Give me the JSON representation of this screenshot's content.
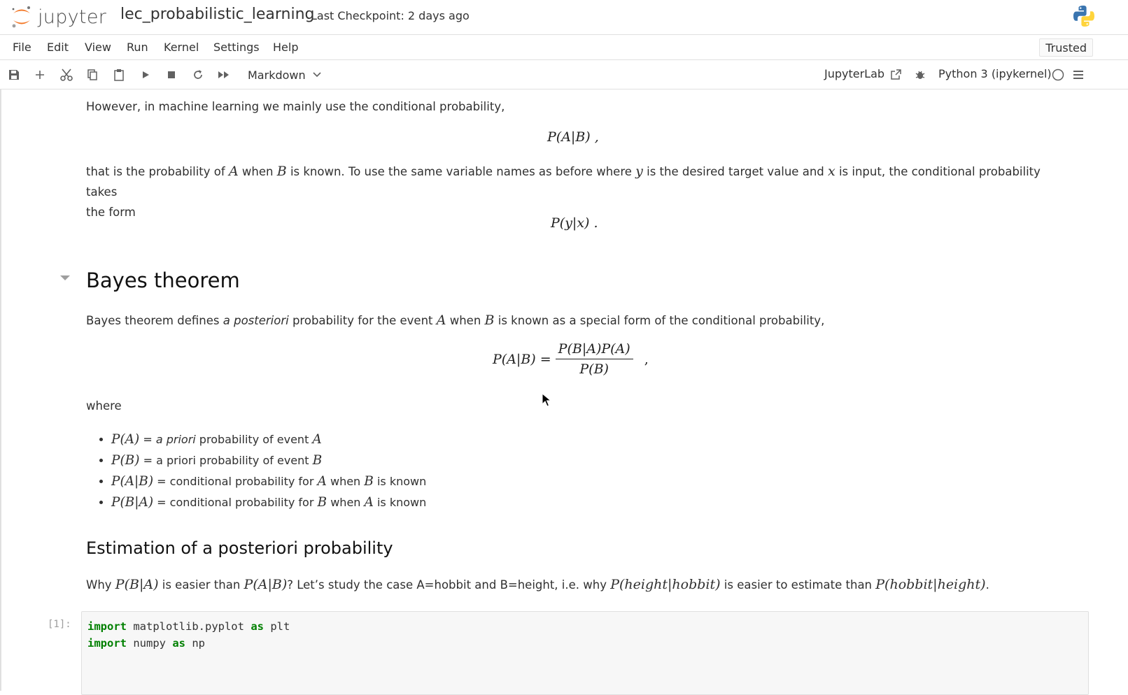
{
  "header": {
    "app_name": "jupyter",
    "notebook_title": "lec_probabilistic_learning",
    "checkpoint": "Last Checkpoint: 2 days ago"
  },
  "menu": {
    "items": [
      "File",
      "Edit",
      "View",
      "Run",
      "Kernel",
      "Settings",
      "Help"
    ],
    "trusted": "Trusted"
  },
  "toolbar": {
    "cell_type": "Markdown",
    "jupyterlab": "JupyterLab",
    "kernel": "Python 3 (ipykernel)"
  },
  "content": {
    "p1": "However, in machine learning we mainly use the conditional probability,",
    "eq1": "P(A|B) ,",
    "p2_a": "that is the probability of ",
    "p2_A": "A",
    "p2_b": " when ",
    "p2_B": "B",
    "p2_c": " is known. To use the same variable names as before where ",
    "p2_y": "y",
    "p2_d": " is the desired target value and ",
    "p2_x": "x",
    "p2_e": " is input, the conditional probability takes",
    "p2_f": "the form",
    "eq2": "P(y|x) .",
    "h2": "Bayes theorem",
    "p3_a": "Bayes theorem defines ",
    "p3_em": "a posteriori",
    "p3_b": " probability for the event ",
    "p3_A": "A",
    "p3_c": " when ",
    "p3_B": "B",
    "p3_d": " is known as a special form of the conditional probability,",
    "eq3_lhs": "P(A|B) =",
    "eq3_num": "P(B|A)P(A)",
    "eq3_den": "P(B)",
    "eq3_tail": ",",
    "where": "where",
    "bullets": [
      {
        "math": "P(A)",
        "t1": " = ",
        "em": "a priori",
        "t2": " probability of event ",
        "v1": "A",
        "t3": "",
        "v2": "",
        "t4": ""
      },
      {
        "math": "P(B)",
        "t1": " = a priori probability of event ",
        "em": "",
        "t2": "",
        "v1": "B",
        "t3": "",
        "v2": "",
        "t4": ""
      },
      {
        "math": "P(A|B)",
        "t1": " = conditional probability for ",
        "em": "",
        "t2": "",
        "v1": "A",
        "t3": " when ",
        "v2": "B",
        "t4": " is known"
      },
      {
        "math": "P(B|A)",
        "t1": " = conditional probability for ",
        "em": "",
        "t2": "",
        "v1": "B",
        "t3": " when ",
        "v2": "A",
        "t4": " is known"
      }
    ],
    "h3": "Estimation of a posteriori probability",
    "p4_a": "Why ",
    "p4_m1": "P(B|A)",
    "p4_b": " is easier than ",
    "p4_m2": "P(A|B)",
    "p4_c": "? Let’s study the case A=hobbit and B=height, i.e. why ",
    "p4_m3": "P(height|hobbit)",
    "p4_d": " is easier to estimate than ",
    "p4_m4": "P(hobbit|height)",
    "p4_e": "."
  },
  "code_cell": {
    "prompt": "[1]:",
    "line1_kw": "import",
    "line1_mod": " matplotlib.pyplot ",
    "line1_as": "as",
    "line1_alias": " plt",
    "line2_kw": "import",
    "line2_mod": " numpy ",
    "line2_as": "as",
    "line2_alias": " np"
  },
  "colors": {
    "jupyter_orange": "#f37726",
    "keyword_green": "#008000"
  }
}
